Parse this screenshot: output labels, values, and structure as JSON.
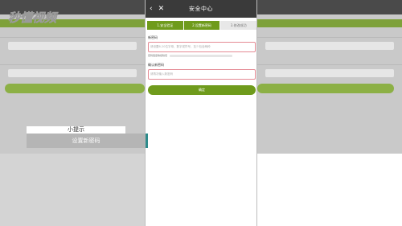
{
  "watermark": {
    "text": "秒懂视频"
  },
  "header": {
    "back_icon": "chevron-left-icon",
    "close_icon": "close-icon",
    "title": "安全中心"
  },
  "steps": [
    {
      "label": "1.安全验证",
      "state": "done"
    },
    {
      "label": "2.设置新密码",
      "state": "active"
    },
    {
      "label": "3.修改成功",
      "state": "pending"
    }
  ],
  "form": {
    "new_password_label": "新密码",
    "new_password_placeholder": "请设置6-20位字母、数字或符号，至少包含两种",
    "strength_hint": "密码强度等级较低",
    "confirm_label": "确认新密码",
    "confirm_placeholder": "请再次输入新密码",
    "submit_label": "确定"
  },
  "tip": {
    "title": "小提示",
    "text": "设置新密码"
  },
  "colors": {
    "brand_green": "#6f9b1c",
    "input_border": "#e58b95",
    "topbar": "#3a3a3a",
    "tip_accent": "#2e8b8b"
  }
}
